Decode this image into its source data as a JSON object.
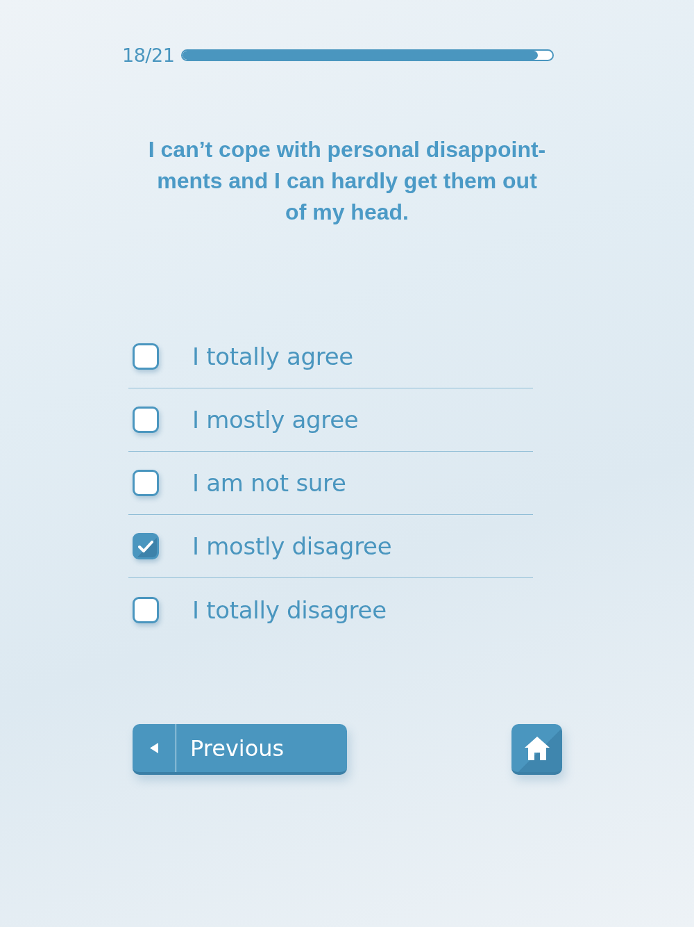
{
  "progress": {
    "label": "18/21",
    "level": 0.96
  },
  "question": "I can’t cope with personal disappoint-\nments and I can hardly get them out\nof my head.",
  "options": [
    {
      "label": "I totally agree",
      "checked": false
    },
    {
      "label": "I mostly agree",
      "checked": false
    },
    {
      "label": "I am not sure",
      "checked": false
    },
    {
      "label": "I mostly disagree",
      "checked": true
    },
    {
      "label": "I totally disagree",
      "checked": false
    }
  ],
  "buttons": [
    {
      "kind": "previous",
      "label": "Previous"
    },
    {
      "kind": "home"
    }
  ]
}
